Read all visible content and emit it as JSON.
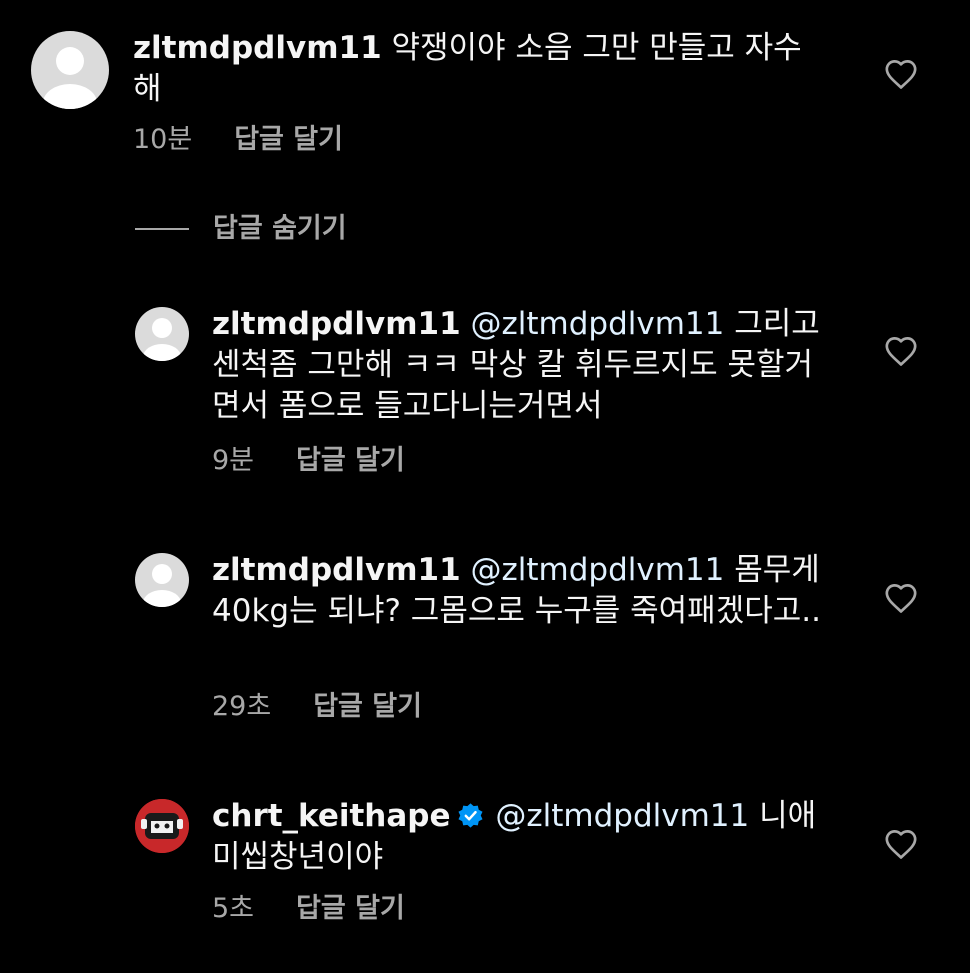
{
  "comments": [
    {
      "username": "zltmdpdlvm11",
      "mention": "",
      "verified": false,
      "text": "약쟁이야 소음 그만 만들고 자수해",
      "time": "10분",
      "reply_label": "답글 달기",
      "avatar": "default-avatar"
    },
    {
      "username": "zltmdpdlvm11",
      "mention": "@zltmdpdlvm11",
      "verified": false,
      "text": "그리고 센척좀 그만해 ㅋㅋ 막상 칼 휘두르지도 못할거면서 폼으로 들고다니는거면서",
      "time": "9분",
      "reply_label": "답글 달기",
      "avatar": "default-avatar"
    },
    {
      "username": "zltmdpdlvm11",
      "mention": "@zltmdpdlvm11",
      "verified": false,
      "text": "몸무게 40kg는 되냐? 그몸으로 누구를 죽여패겠다고..",
      "time": "29초",
      "reply_label": "답글 달기",
      "avatar": "default-avatar"
    },
    {
      "username": "chrt_keithape",
      "mention": "@zltmdpdlvm11",
      "verified": true,
      "text": "니애미씹창년이야",
      "time": "5초",
      "reply_label": "답글 달기",
      "avatar": "profile-avatar"
    }
  ],
  "hide_replies_label": "답글 숨기기",
  "colors": {
    "background": "#000000",
    "text": "#f5f5f5",
    "secondary": "#a8a8a8",
    "mention": "#e0f1ff",
    "verified": "#0095f6",
    "avatar_red": "#c8282a"
  },
  "icons": {
    "like": "heart-outline-icon",
    "verified": "verified-badge-icon",
    "default_avatar": "person-silhouette-icon"
  }
}
